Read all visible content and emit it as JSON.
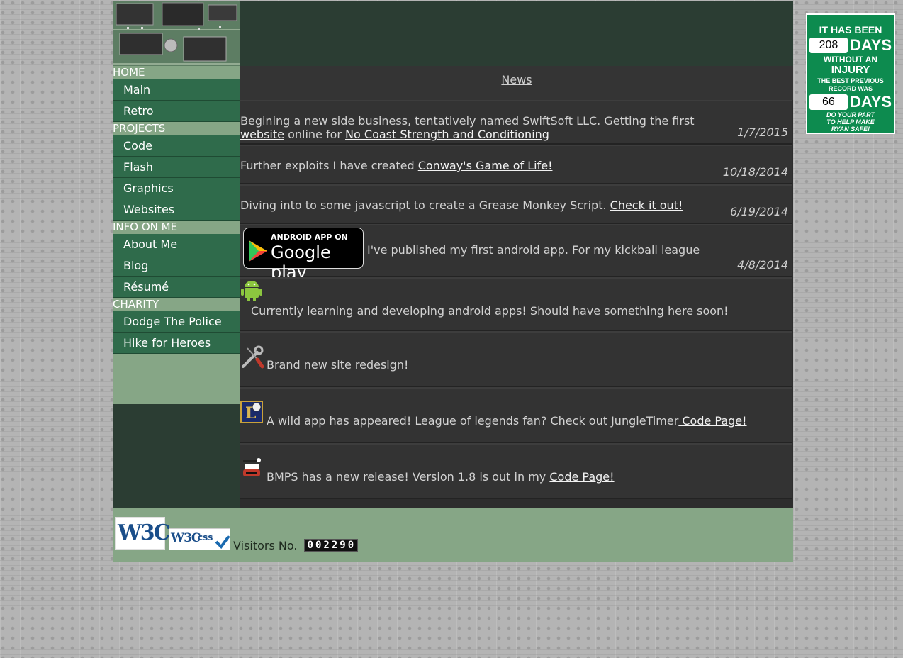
{
  "sidebar": {
    "sections": [
      {
        "title": "HOME",
        "items": [
          "Main",
          "Retro"
        ]
      },
      {
        "title": "PROJECTS",
        "items": [
          "Code",
          "Flash",
          "Graphics",
          "Websites"
        ]
      },
      {
        "title": "INFO ON ME",
        "items": [
          "About Me",
          "Blog",
          "Résumé"
        ]
      },
      {
        "title": "CHARITY",
        "items": [
          "Dodge The Police",
          "Hike for Heroes"
        ]
      }
    ]
  },
  "news": {
    "heading": "News",
    "posts": [
      {
        "text1": "Begining a new side business, tentatively named SwiftSoft LLC. Getting the first ",
        "link1": "website",
        "text2": " online for ",
        "link2": "No Coast Strength and Conditioning",
        "date": "1/7/2015"
      },
      {
        "text1": "Further exploits I have created ",
        "link1": "Conway's Game of Life!",
        "date": "10/18/2014"
      },
      {
        "text1": "Diving into to some javascript to create a Grease Monkey Script. ",
        "link1": "Check it out!",
        "date": "6/19/2014"
      },
      {
        "badge_line1": "ANDROID APP ON",
        "badge_line2": "Google play",
        "text1": "I've published my first android app. For my kickball league",
        "date": "4/8/2014"
      },
      {
        "text1": "Currently learning and developing android apps! Should have something here soon!"
      },
      {
        "text1": "Brand new site redesign!"
      },
      {
        "text1": "A wild app has appeared! League of legends fan? Check out JungleTimer",
        "link1": " Code Page!"
      },
      {
        "text1": "BMPS has a new release! Version 1.8 is out in my ",
        "link1": "Code Page!"
      }
    ]
  },
  "footer": {
    "w3c_label": "W3C",
    "css_label": "css",
    "visitors_label": "Visitors No.",
    "visitor_count": "002290"
  },
  "sign": {
    "line1": "IT HAS BEEN",
    "days_count": "208",
    "days_label": "DAYS",
    "line2": "WITHOUT AN",
    "line3": "INJURY",
    "line4": "THE BEST PREVIOUS",
    "line5": "RECORD WAS",
    "best_count": "66",
    "best_label": "DAYS",
    "line6": "DO YOUR PART",
    "line7": "TO HELP MAKE",
    "line8": "RYAN SAFE!"
  },
  "colors": {
    "sidebar_item": "#2f6b4b",
    "sidebar_section": "#86a686",
    "content_bg": "#2d2d2d",
    "sign_green": "#0d8b4f"
  }
}
